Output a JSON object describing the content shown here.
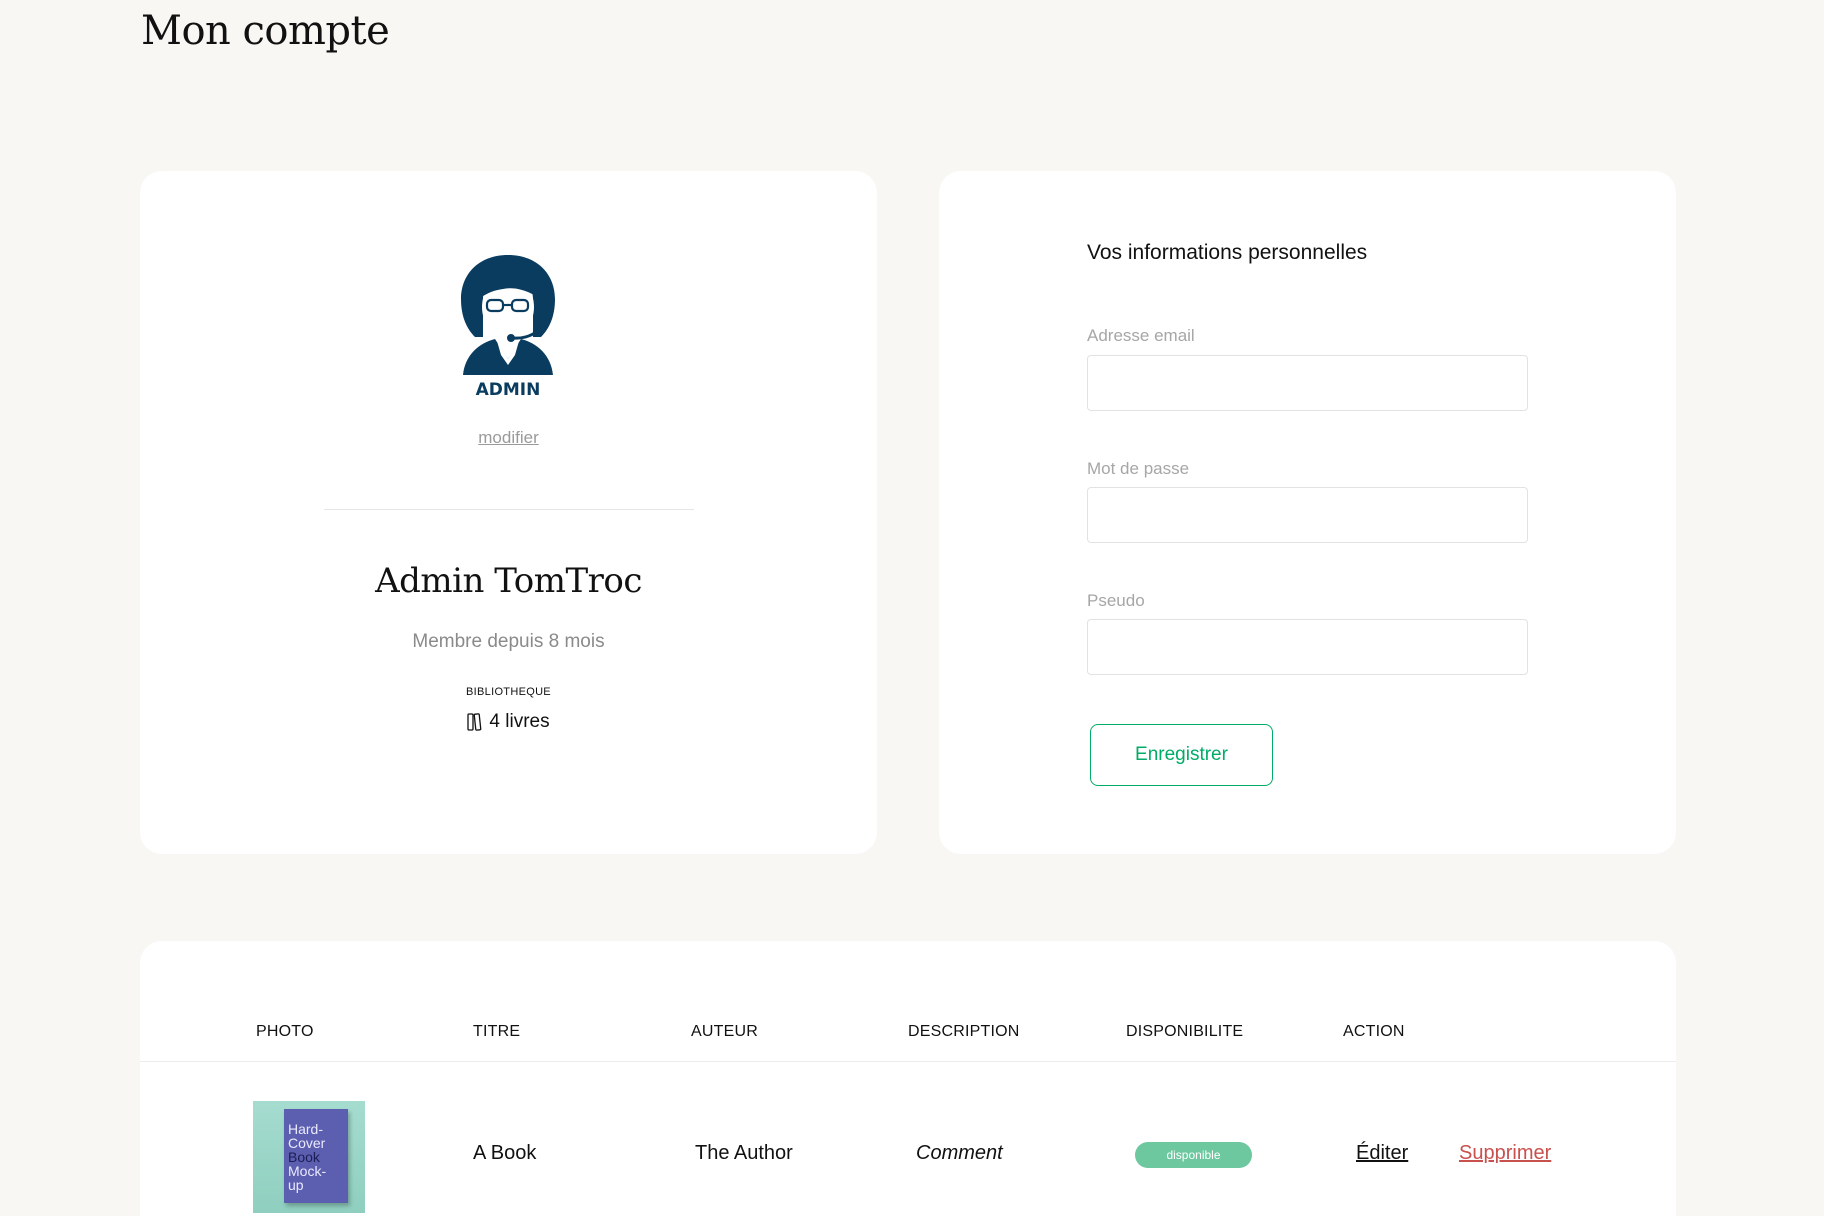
{
  "page": {
    "title": "Mon compte"
  },
  "profile": {
    "avatar_badge_text": "ADMIN",
    "modify_label": "modifier",
    "name": "Admin TomTroc",
    "member_since": "Membre depuis 8 mois",
    "library_label": "BIBLIOTHEQUE",
    "books_count": "4 livres",
    "avatar_color": "#0a3c5f"
  },
  "info": {
    "title": "Vos informations personnelles",
    "email_label": "Adresse email",
    "email_value": "",
    "password_label": "Mot de passe",
    "password_value": "",
    "pseudo_label": "Pseudo",
    "pseudo_value": "",
    "save_label": "Enregistrer",
    "accent_color": "#00ac66"
  },
  "books": {
    "headers": [
      "PHOTO",
      "TITRE",
      "AUTEUR",
      "DESCRIPTION",
      "DISPONIBILITE",
      "ACTION"
    ],
    "rows": [
      {
        "cover_text": [
          "Hard-",
          "Cover",
          "Book",
          "Mock-",
          "up"
        ],
        "title": "A Book",
        "author": "The Author",
        "description": "Comment",
        "availability": "disponible",
        "edit_label": "Éditer",
        "delete_label": "Supprimer"
      }
    ],
    "badge_color": "#6dc8a0",
    "delete_color": "#c8504d"
  }
}
